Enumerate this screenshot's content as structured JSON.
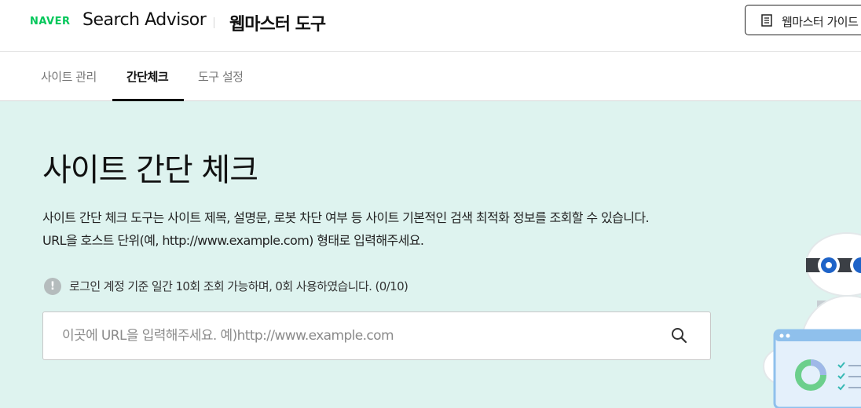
{
  "header": {
    "brand": "NAVER",
    "product": "Search Advisor",
    "tool_title": "웹마스터 도구",
    "guide_button": {
      "label": "웹마스터 가이드",
      "icon": "document-list-icon"
    }
  },
  "tabs": [
    {
      "label": "사이트 관리",
      "active": false
    },
    {
      "label": "간단체크",
      "active": true
    },
    {
      "label": "도구 설정",
      "active": false
    }
  ],
  "main": {
    "title": "사이트 간단 체크",
    "description_line1": "사이트 간단 체크 도구는 사이트 제목, 설명문, 로봇 차단 여부 등 사이트 기본적인 검색 최적화 정보를 조회할 수 있습니다.",
    "description_line2": "URL을 호스트 단위(예, http://www.example.com) 형태로 입력해주세요.",
    "notice": {
      "icon": "info-icon",
      "icon_glyph": "!",
      "text": "로그인 계정 기준 일간 10회 조회 가능하며, 0회 사용하였습니다. (0/10)"
    },
    "search": {
      "placeholder": "이곳에 URL을 입력해주세요. 예)http://www.example.com",
      "value": "",
      "icon": "search-icon"
    }
  },
  "colors": {
    "brand_green": "#03c75a",
    "main_background": "#def3ef",
    "active_tab_underline": "#111111",
    "info_icon": "#b5bcbd"
  }
}
